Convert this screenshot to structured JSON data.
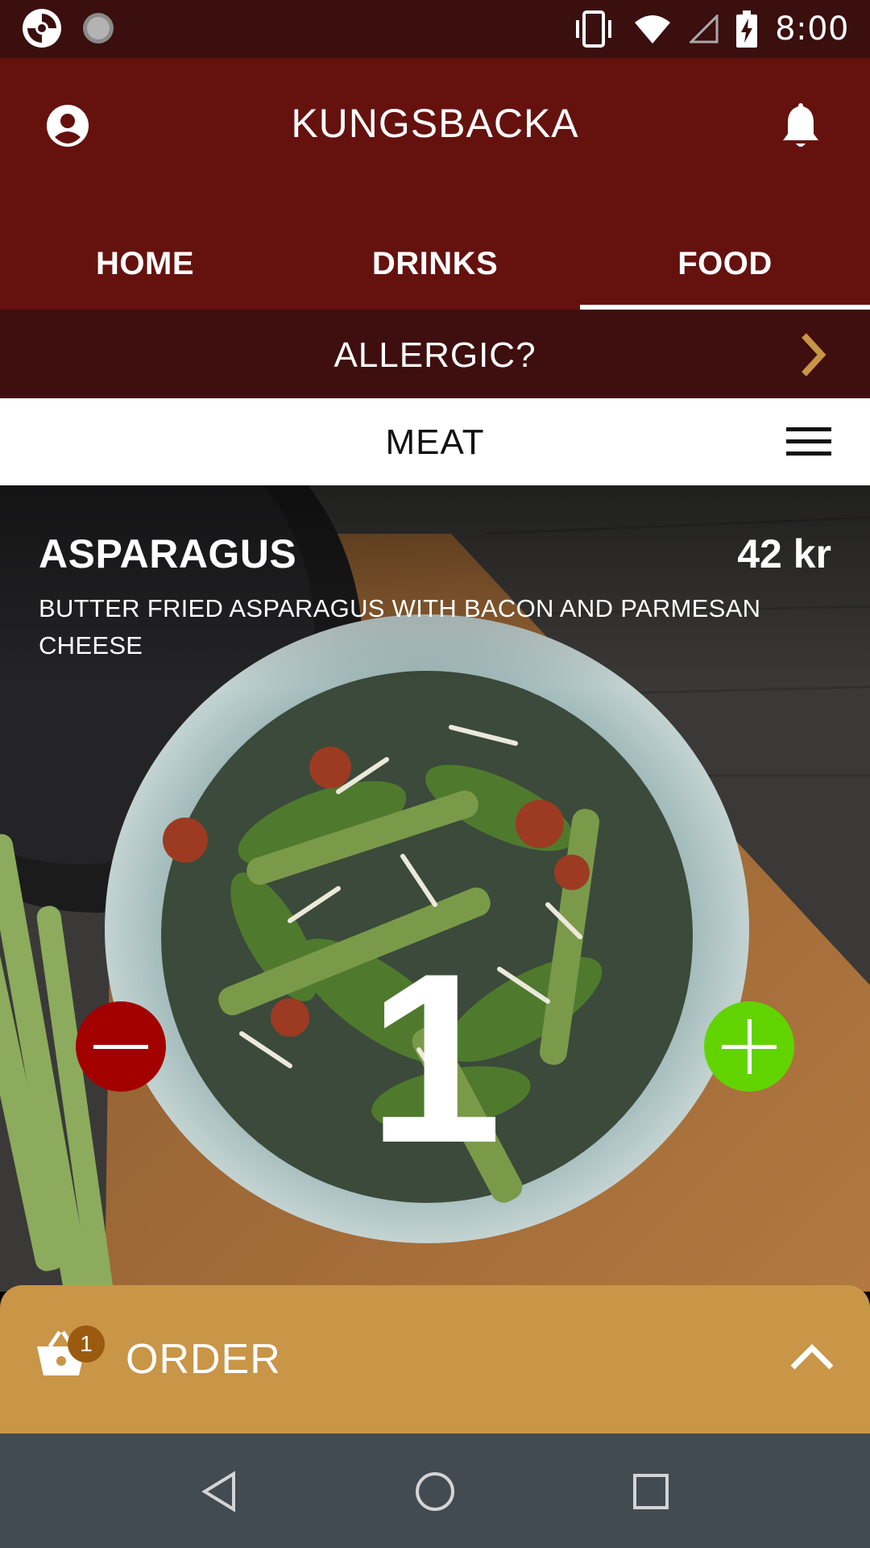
{
  "status_bar": {
    "time": "8:00",
    "left_icons": [
      "app-logo-icon",
      "loading-icon"
    ],
    "right_icons": [
      "vibrate-icon",
      "wifi-icon",
      "signal-icon",
      "battery-charging-icon"
    ]
  },
  "app_bar": {
    "title": "KUNGSBACKA",
    "profile_icon": "account-circle-icon",
    "notification_icon": "bell-icon"
  },
  "tabs": [
    {
      "label": "HOME",
      "active": false
    },
    {
      "label": "DRINKS",
      "active": false
    },
    {
      "label": "FOOD",
      "active": true
    }
  ],
  "allergic": {
    "label": "ALLERGIC?"
  },
  "category": {
    "label": "MEAT"
  },
  "item": {
    "name": "ASPARAGUS",
    "price": "42 kr",
    "description": "BUTTER FRIED ASPARAGUS WITH BACON AND PARMESAN CHEESE",
    "quantity": "1"
  },
  "order_bar": {
    "label": "ORDER",
    "cart_count": "1"
  },
  "colors": {
    "status_bar": "#3a0f0e",
    "app_bar": "#65120f",
    "allergic_bar": "#3e0f0e",
    "accent_gold": "#c99547",
    "minus": "#a30000",
    "plus": "#61d400",
    "nav_bar": "#424b52"
  }
}
